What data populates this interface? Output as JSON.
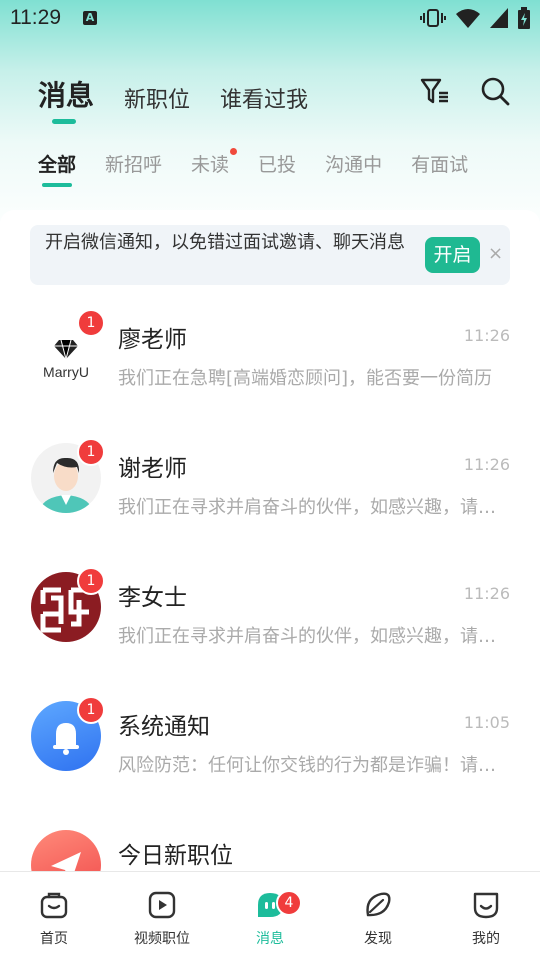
{
  "status_bar": {
    "time": "11:29"
  },
  "header": {
    "tabs": [
      {
        "label": "消息",
        "active": true
      },
      {
        "label": "新职位",
        "active": false
      },
      {
        "label": "谁看过我",
        "active": false
      }
    ],
    "icons": [
      "filter-icon",
      "search-icon"
    ]
  },
  "subtabs": [
    {
      "label": "全部",
      "active": true
    },
    {
      "label": "新招呼"
    },
    {
      "label": "未读",
      "dot": true
    },
    {
      "label": "已投"
    },
    {
      "label": "沟通中"
    },
    {
      "label": "有面试"
    }
  ],
  "notice": {
    "text": "开启微信通知，以免错过面试邀请、聊天消息",
    "button": "开启",
    "close": "×"
  },
  "chats": [
    {
      "name": "廖老师",
      "time": "11:26",
      "message": "我们正在急聘[高端婚恋顾问]，能否要一份简历",
      "badge": "1",
      "avatar": "marryu-logo",
      "logo_text": "MarryU"
    },
    {
      "name": "谢老师",
      "time": "11:26",
      "message": "我们正在寻求并肩奋斗的伙伴，如感兴趣，请回复",
      "badge": "1",
      "avatar": "person-avatar"
    },
    {
      "name": "李女士",
      "time": "11:26",
      "message": "我们正在寻求并肩奋斗的伙伴，如感兴趣，请回复",
      "badge": "1",
      "avatar": "seal-logo"
    },
    {
      "name": "系统通知",
      "time": "11:05",
      "message": "风险防范：任何让你交钱的行为都是诈骗！请提高警惕",
      "badge": "1",
      "avatar": "bell-avatar"
    },
    {
      "name": "今日新职位",
      "time": "",
      "message": "",
      "badge": "",
      "avatar": "paper-plane-avatar"
    }
  ],
  "bottom_nav": [
    {
      "label": "首页",
      "icon": "home-bag-icon"
    },
    {
      "label": "视频职位",
      "icon": "video-icon"
    },
    {
      "label": "消息",
      "icon": "message-icon",
      "active": true,
      "badge": "4"
    },
    {
      "label": "发现",
      "icon": "discover-icon"
    },
    {
      "label": "我的",
      "icon": "profile-icon"
    }
  ],
  "colors": {
    "accent": "#1dbc9b",
    "badge": "#f03c3c",
    "button": "#1fb992"
  }
}
